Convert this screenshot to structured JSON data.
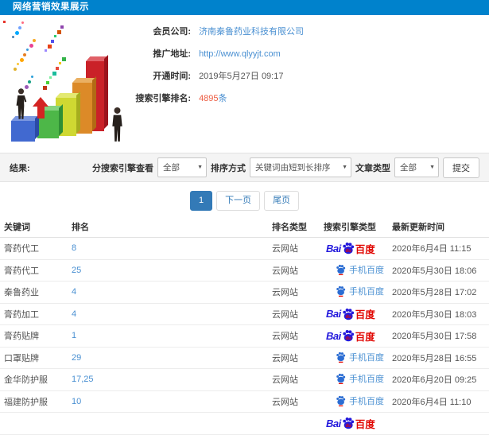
{
  "colors": {
    "topbar_blue": "#0082cc",
    "link_blue": "#4a90d2",
    "count_red": "#ec5b41",
    "pagination_active_blue": "#337ab7",
    "baidu_blue": "#2319dc",
    "baidu_red": "#e10601",
    "filterbar_gray": "#f4f4f4"
  },
  "topbar": {
    "title": "网络营销效果展示"
  },
  "info": {
    "rows": [
      {
        "label": "会员公司:",
        "value": "济南秦鲁药业科技有限公司"
      },
      {
        "label": "推广地址:",
        "value": "http://www.qlyyjt.com"
      },
      {
        "label": "开通时间:",
        "value": "2019年5月27日 09:17"
      },
      {
        "label": "搜索引擎排名:",
        "value": "4895",
        "suffix": "条"
      }
    ]
  },
  "filter": {
    "result_label": "结果:",
    "engine_view_label": "分搜索引擎查看",
    "engine_view_value": "全部",
    "sort_label": "排序方式",
    "sort_value": "关键词由短到长排序",
    "article_type_label": "文章类型",
    "article_type_value": "全部",
    "submit_label": "提交"
  },
  "pagination": {
    "current": "1",
    "next": "下一页",
    "last": "尾页"
  },
  "table": {
    "headers": [
      "关键词",
      "排名",
      "排名类型",
      "搜索引擎类型",
      "最新更新时间"
    ],
    "engine_logos": {
      "baidu": {
        "latin": "Bai",
        "du": "du",
        "cn": "百度"
      },
      "mobile": {
        "label": "手机百度"
      }
    },
    "rows": [
      {
        "keyword": "膏药代工",
        "rank": "8",
        "rank_type": "云网站",
        "engine": "baidu",
        "updated": "2020年6月4日 11:15"
      },
      {
        "keyword": "膏药代工",
        "rank": "25",
        "rank_type": "云网站",
        "engine": "mobile",
        "updated": "2020年5月30日 18:06"
      },
      {
        "keyword": "秦鲁药业",
        "rank": "4",
        "rank_type": "云网站",
        "engine": "mobile",
        "updated": "2020年5月28日 17:02"
      },
      {
        "keyword": "膏药加工",
        "rank": "4",
        "rank_type": "云网站",
        "engine": "baidu",
        "updated": "2020年5月30日 18:03"
      },
      {
        "keyword": "膏药贴牌",
        "rank": "1",
        "rank_type": "云网站",
        "engine": "baidu",
        "updated": "2020年5月30日 17:58"
      },
      {
        "keyword": "口罩贴牌",
        "rank": "29",
        "rank_type": "云网站",
        "engine": "mobile",
        "updated": "2020年5月28日 16:55"
      },
      {
        "keyword": "金华防护服",
        "rank": "17,25",
        "rank_type": "云网站",
        "engine": "mobile",
        "updated": "2020年6月20日 09:25"
      },
      {
        "keyword": "福建防护服",
        "rank": "10",
        "rank_type": "云网站",
        "engine": "mobile",
        "updated": "2020年6月4日 11:10"
      },
      {
        "keyword": "",
        "rank": "",
        "rank_type": "",
        "engine": "baidu",
        "updated": "",
        "partial": true
      }
    ]
  },
  "illustration": {
    "description": "3d-growth-bar-chart-with-businessmen",
    "confetti_colors": [
      "#e6332a",
      "#f7a823",
      "#35b44a",
      "#2b9fd9",
      "#8e44ad",
      "#e84393",
      "#f1c40f",
      "#16a085",
      "#d35400",
      "#3498db",
      "#e74c3c",
      "#9b59b6",
      "#2ecc71",
      "#e67e22",
      "#1abc9c",
      "#ff6b81",
      "#5352ed",
      "#ffa502",
      "#7bed9f",
      "#70a1ff",
      "#e84118",
      "#fbc531",
      "#4cd137",
      "#00a8ff",
      "#9c88ff",
      "#e1b12c",
      "#c23616",
      "#487eb0"
    ]
  }
}
